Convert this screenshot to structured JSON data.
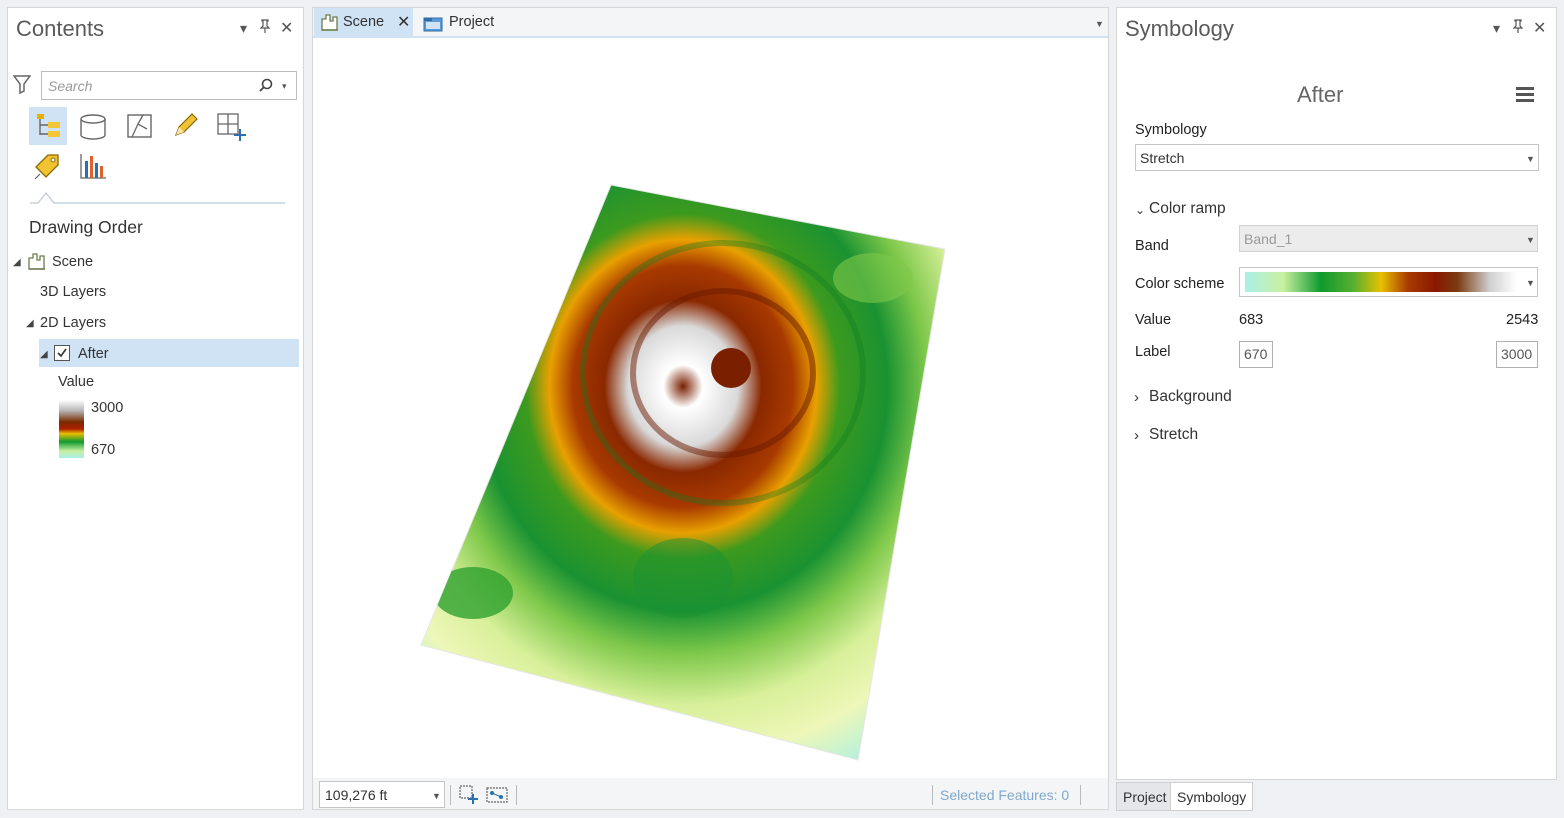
{
  "contents": {
    "title": "Contents",
    "search_placeholder": "Search",
    "section_title": "Drawing Order",
    "tree": {
      "scene": "Scene",
      "layers_3d": "3D Layers",
      "layers_2d": "2D Layers",
      "layer_after": "After",
      "legend_field": "Value",
      "legend_high": "3000",
      "legend_low": "670"
    }
  },
  "view": {
    "tabs": [
      {
        "label": "Scene",
        "active": true
      },
      {
        "label": "Project",
        "active": false
      }
    ],
    "scale": "109,276 ft",
    "selected_features": "Selected Features: 0"
  },
  "symbology": {
    "title": "Symbology",
    "layer_name": "After",
    "symbology_label": "Symbology",
    "symbology_value": "Stretch",
    "color_ramp_header": "Color ramp",
    "band_label": "Band",
    "band_value": "Band_1",
    "color_scheme_label": "Color scheme",
    "value_label": "Value",
    "value_min": "683",
    "value_max": "2543",
    "label_label": "Label",
    "label_min": "670",
    "label_max": "3000",
    "background_header": "Background",
    "stretch_header": "Stretch"
  },
  "bottom_tabs": [
    "Project",
    "Symbology"
  ],
  "colors": {
    "accent": "#cfe3f5",
    "ramp": [
      "#aaf0e8",
      "#c8f0a0",
      "#0f9a2e",
      "#e8c000",
      "#8a1800",
      "#7a2a00",
      "#ffffff"
    ]
  }
}
